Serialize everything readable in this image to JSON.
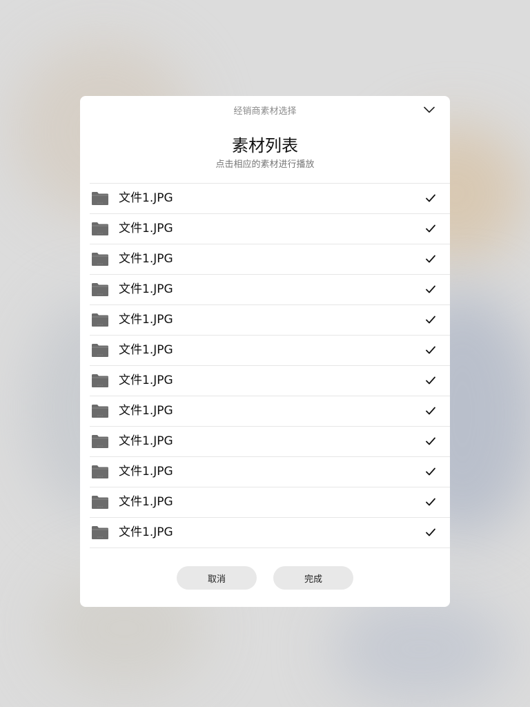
{
  "dialog": {
    "header_title": "经销商素材选择",
    "collapse_icon": "chevron-down-icon",
    "title": "素材列表",
    "subtitle": "点击相应的素材进行播放"
  },
  "files": [
    {
      "name": "文件1.JPG",
      "icon": "folder-icon",
      "checked": true
    },
    {
      "name": "文件1.JPG",
      "icon": "folder-icon",
      "checked": true
    },
    {
      "name": "文件1.JPG",
      "icon": "folder-icon",
      "checked": true
    },
    {
      "name": "文件1.JPG",
      "icon": "folder-icon",
      "checked": true
    },
    {
      "name": "文件1.JPG",
      "icon": "folder-icon",
      "checked": true
    },
    {
      "name": "文件1.JPG",
      "icon": "folder-icon",
      "checked": true
    },
    {
      "name": "文件1.JPG",
      "icon": "folder-icon",
      "checked": true
    },
    {
      "name": "文件1.JPG",
      "icon": "folder-icon",
      "checked": true
    },
    {
      "name": "文件1.JPG",
      "icon": "folder-icon",
      "checked": true
    },
    {
      "name": "文件1.JPG",
      "icon": "folder-icon",
      "checked": true
    },
    {
      "name": "文件1.JPG",
      "icon": "folder-icon",
      "checked": true
    },
    {
      "name": "文件1.JPG",
      "icon": "folder-icon",
      "checked": true
    }
  ],
  "buttons": {
    "cancel_label": "取消",
    "done_label": "完成"
  },
  "colors": {
    "folder": "#6b6b6b",
    "button_bg": "#e8e8e8",
    "divider": "#e6e6e6"
  }
}
